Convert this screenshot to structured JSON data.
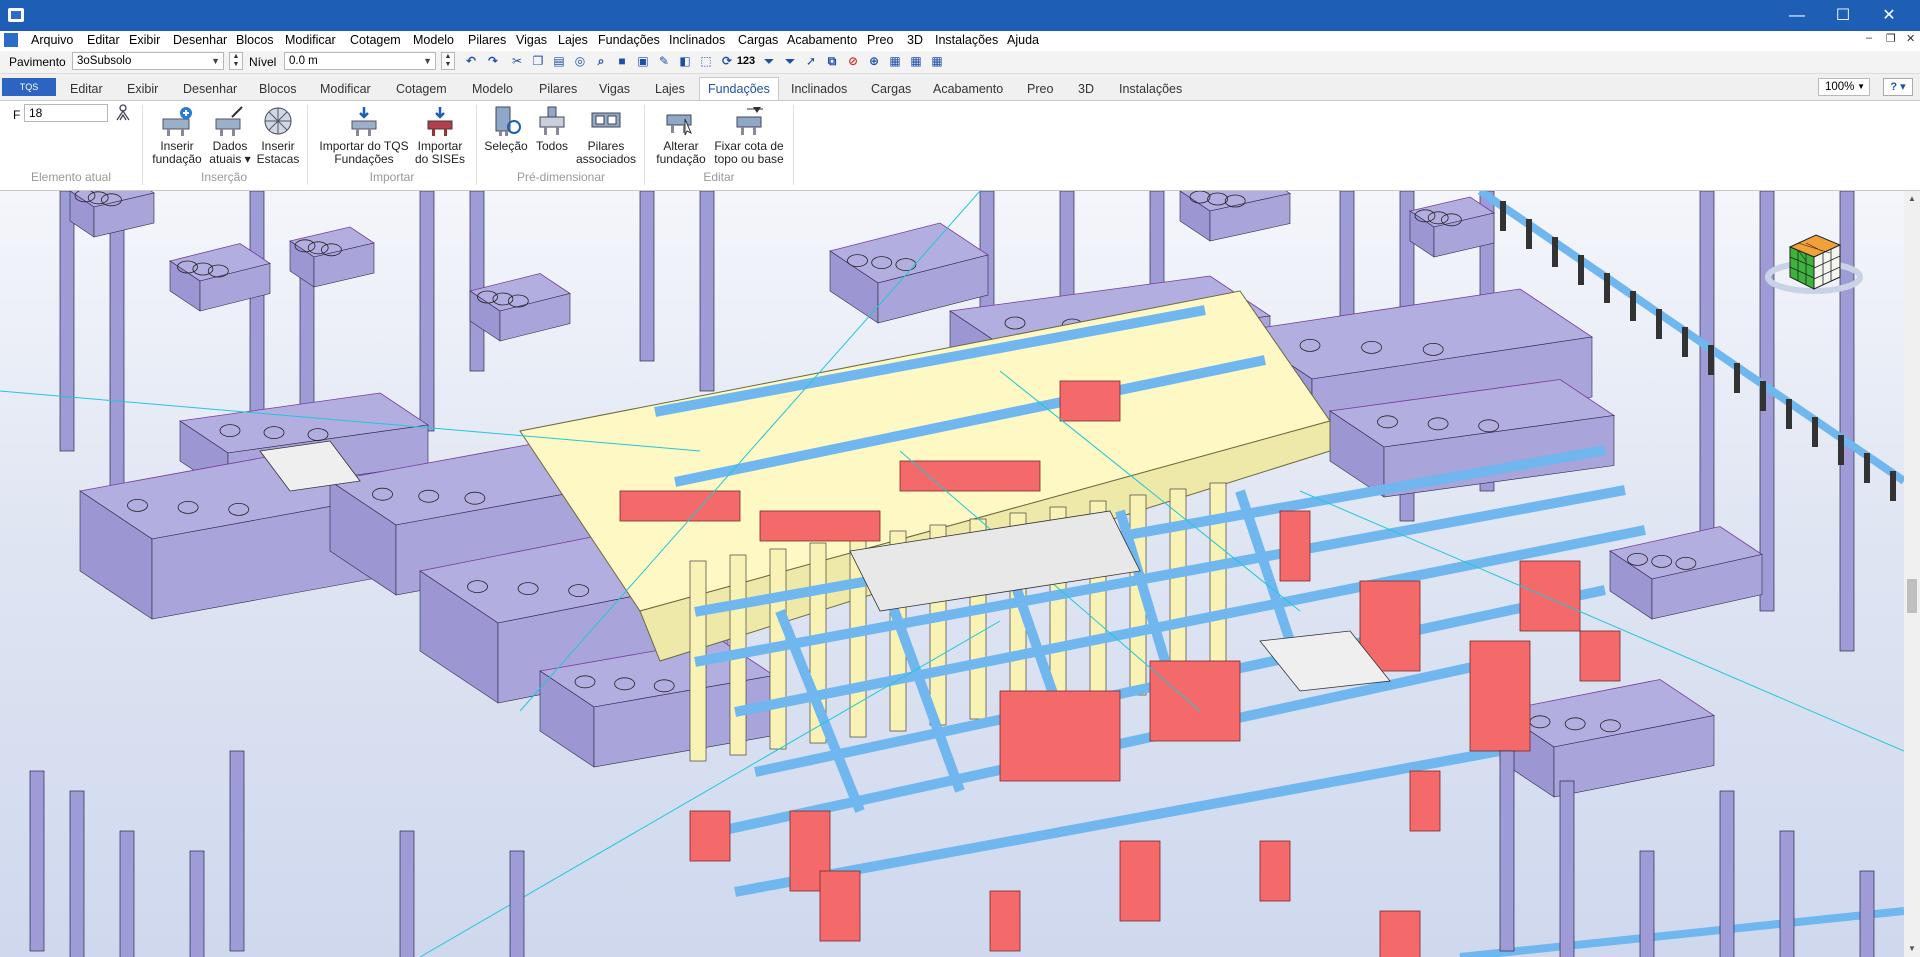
{
  "window": {
    "title": "",
    "controls": [
      "—",
      "☐",
      "✕"
    ]
  },
  "menu": [
    "Arquivo",
    "Editar",
    "Exibir",
    "Desenhar",
    "Blocos",
    "Modificar",
    "Cotagem",
    "Modelo",
    "Pilares",
    "Vigas",
    "Lajes",
    "Fundações",
    "Inclinados",
    "Cargas",
    "Acabamento",
    "Preo",
    "3D",
    "Instalações",
    "Ajuda"
  ],
  "toolbar": {
    "pavimento_label": "Pavimento",
    "pavimento_value": "3oSubsolo",
    "nivel_label": "Nível",
    "nivel_value": "0.0 m",
    "icons": [
      "undo-icon",
      "redo-icon",
      "cut-icon",
      "copy-icon",
      "paste-icon",
      "binoculars-icon",
      "find-icon",
      "save-icon",
      "save-all-icon",
      "properties-icon",
      "layers-icon",
      "select-icon",
      "rotate-icon",
      "numbering-icon",
      "filter-icon",
      "filter-plus-icon",
      "arrow-icon",
      "duplicate-icon",
      "erase-icon",
      "zoom-icon",
      "window-icon",
      "window-plus-icon",
      "window-refresh-icon"
    ],
    "numbering_text": "123"
  },
  "tabs": {
    "app_button": "TQS",
    "items": [
      "Editar",
      "Exibir",
      "Desenhar",
      "Blocos",
      "Modificar",
      "Cotagem",
      "Modelo",
      "Pilares",
      "Vigas",
      "Lajes",
      "Fundações",
      "Inclinados",
      "Cargas",
      "Acabamento",
      "Preo",
      "3D",
      "Instalações"
    ],
    "active": "Fundações",
    "zoom": "100%",
    "help": "?"
  },
  "ribbon": {
    "elemento": {
      "label": "F",
      "value": "18",
      "group": "Elemento atual"
    },
    "groups": [
      {
        "name": "Inserção",
        "buttons": [
          {
            "line1": "Inserir",
            "line2": "fundação",
            "icon": "insert-foundation-icon"
          },
          {
            "line1": "Dados",
            "line2": "atuais ▾",
            "icon": "current-data-icon"
          },
          {
            "line1": "Inserir",
            "line2": "Estacas",
            "icon": "insert-piles-icon"
          }
        ]
      },
      {
        "name": "Importar",
        "buttons": [
          {
            "line1": "Importar do TQS",
            "line2": "Fundações",
            "icon": "import-tqs-icon"
          },
          {
            "line1": "Importar",
            "line2": "do SISEs",
            "icon": "import-sises-icon"
          }
        ]
      },
      {
        "name": "Pré-dimensionar",
        "buttons": [
          {
            "line1": "Seleção",
            "line2": "",
            "icon": "selection-icon"
          },
          {
            "line1": "Todos",
            "line2": "",
            "icon": "all-icon"
          },
          {
            "line1": "Pilares",
            "line2": "associados",
            "icon": "associated-columns-icon"
          }
        ]
      },
      {
        "name": "Editar",
        "buttons": [
          {
            "line1": "Alterar",
            "line2": "fundação",
            "icon": "edit-foundation-icon"
          },
          {
            "line1": "Fixar cota de",
            "line2": "topo ou base",
            "icon": "fix-elevation-icon"
          }
        ]
      }
    ]
  },
  "view3d": {
    "description_icon": "view-cube-icon",
    "colors": {
      "cap": "#b3aee0",
      "pile": "#9f9bd6",
      "beam": "#6fb7ee",
      "red": "#f46a6a",
      "slab": "#fdf8c4"
    }
  }
}
